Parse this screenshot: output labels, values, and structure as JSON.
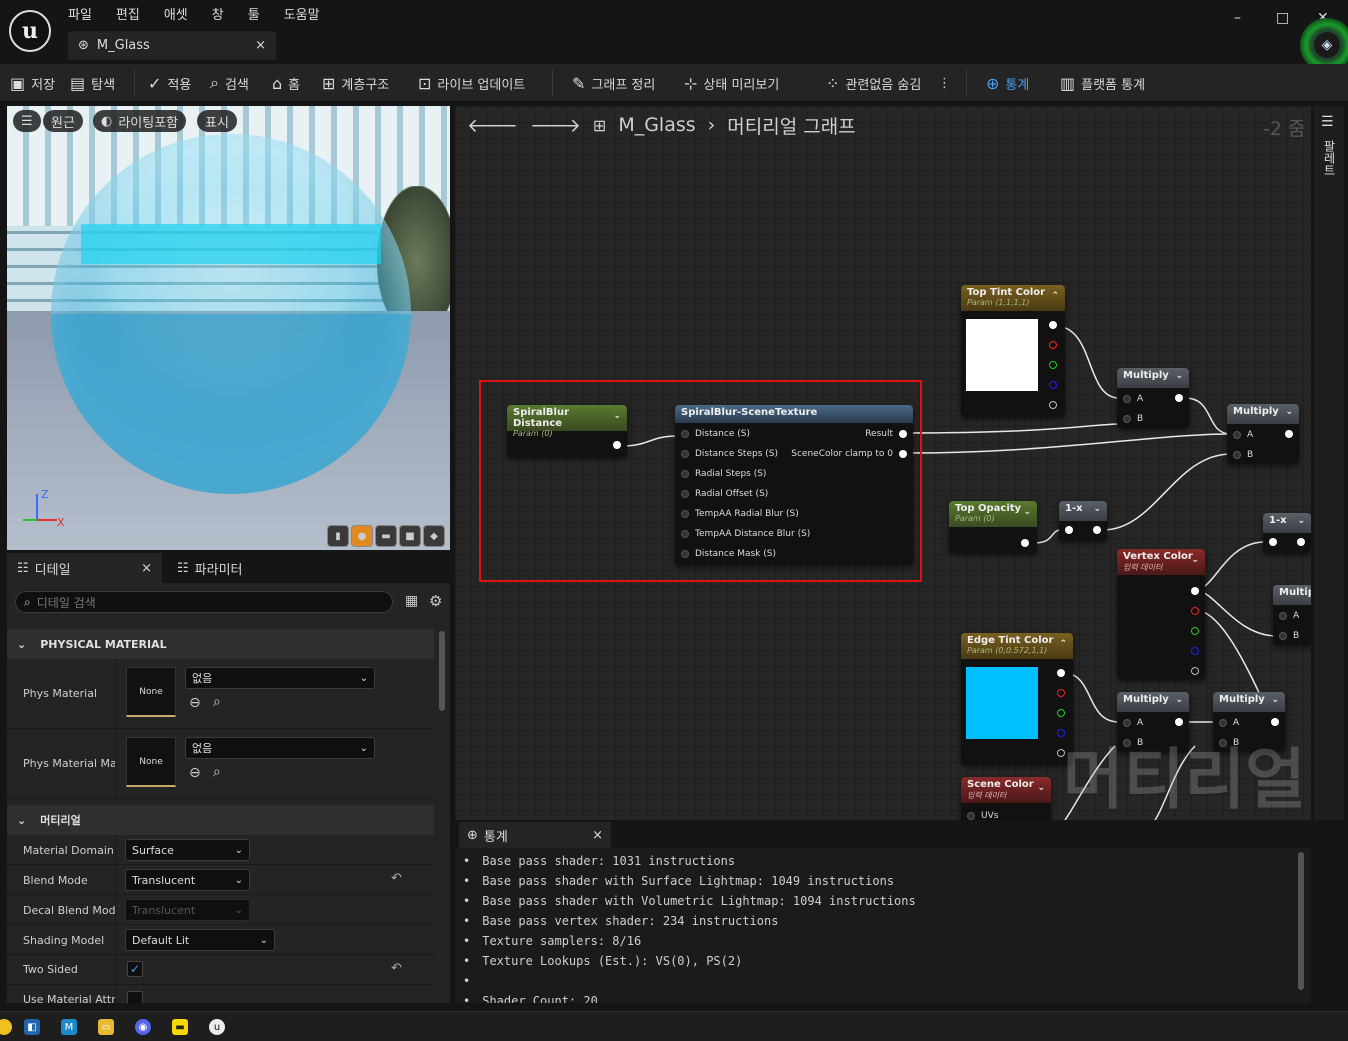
{
  "menu": {
    "items": [
      "파일",
      "편집",
      "애셋",
      "창",
      "툴",
      "도움말"
    ]
  },
  "doc_tab": {
    "label": "M_Glass",
    "close": "×"
  },
  "window": {
    "minimize": "–",
    "maximize": "□",
    "close": "✕"
  },
  "toolbar": {
    "save": "저장",
    "browse": "탐색",
    "apply": "적용",
    "search": "검색",
    "home": "홈",
    "hierarchy": "계층구조",
    "live_update": "라이브 업데이트",
    "clean_graph": "그래프 정리",
    "preview_state": "상태 미리보기",
    "hide_unrelated": "관련없음 숨김",
    "more": "⋮",
    "stats": "통계",
    "platform_stats": "플랫폼 통계"
  },
  "viewport": {
    "menu": "☰",
    "perspective": "원근",
    "lit": "라이팅포함",
    "show": "표시",
    "axis_z": "Z",
    "axis_x": "X",
    "preview_shapes": [
      "cylinder",
      "sphere",
      "plane",
      "cube",
      "custom"
    ],
    "selected_shape": "sphere"
  },
  "details": {
    "tab_details": "디테일",
    "tab_close": "×",
    "tab_params": "파라미터",
    "search_placeholder": "디테일 검색",
    "cat_physical": "PHYSICAL MATERIAL",
    "phys_material_label": "Phys Material",
    "phys_material_thumb": "None",
    "phys_material_value": "없음",
    "phys_material_mask_label": "Phys Material Ma",
    "phys_material_mask_thumb": "None",
    "phys_material_mask_value": "없음",
    "cat_material": "머티리얼",
    "material_domain_label": "Material Domain",
    "material_domain_value": "Surface",
    "blend_mode_label": "Blend Mode",
    "blend_mode_value": "Translucent",
    "decal_blend_label": "Decal Blend Mode",
    "decal_blend_value": "Translucent",
    "shading_model_label": "Shading Model",
    "shading_model_value": "Default Lit",
    "two_sided_label": "Two Sided",
    "two_sided_checked": "✓",
    "use_material_attr_label": "Use Material Attri"
  },
  "graph": {
    "back": "🡐",
    "forward": "🡒",
    "breadcrumb_asset": "M_Glass",
    "breadcrumb_sep": "›",
    "breadcrumb_graph": "머티리얼 그래프",
    "zoom": "-2 줌",
    "palette": "팔레트",
    "watermark": "머티리얼",
    "nodes": {
      "spiral_distance": {
        "title": "SpiralBlur Distance",
        "sub": "Param (0)"
      },
      "spiral_scene": {
        "title": "SpiralBlur-SceneTexture",
        "inputs": [
          "Distance (S)",
          "Distance Steps (S)",
          "Radial Steps (S)",
          "Radial Offset (S)",
          "TempAA Radial Blur (S)",
          "TempAA Distance Blur (S)",
          "Distance Mask (S)"
        ],
        "outputs": [
          "Result",
          "SceneColor clamp to 0"
        ]
      },
      "top_tint": {
        "title": "Top Tint Color",
        "sub": "Param (1,1,1,1)",
        "color": "#ffffff"
      },
      "top_opacity": {
        "title": "Top Opacity",
        "sub": "Param (0)"
      },
      "one_minus_1": {
        "title": "1-x"
      },
      "one_minus_2": {
        "title": "1-x"
      },
      "multiply_1": {
        "title": "Multiply",
        "a": "A",
        "b": "B"
      },
      "multiply_2": {
        "title": "Multiply",
        "a": "A",
        "b": "B"
      },
      "multiply_3": {
        "title": "Multip",
        "a": "A",
        "b": "B"
      },
      "multiply_4": {
        "title": "Multiply",
        "a": "A",
        "b": "B"
      },
      "multiply_5": {
        "title": "Multiply",
        "a": "A",
        "b": "B"
      },
      "vertex_color": {
        "title": "Vertex Color",
        "sub": "입력 데이터"
      },
      "edge_tint": {
        "title": "Edge Tint Color",
        "sub": "Param (0,0.572,1,1)",
        "color": "#00bfff"
      },
      "scene_color": {
        "title": "Scene Color",
        "sub": "입력 데이터",
        "pin": "UVs"
      }
    }
  },
  "stats": {
    "tab": "통계",
    "tab_close": "×",
    "lines": [
      "Base pass shader: 1031 instructions",
      "Base pass shader with Surface Lightmap: 1049 instructions",
      "Base pass shader with Volumetric Lightmap: 1094 instructions",
      "Base pass vertex shader: 234 instructions",
      "Texture samplers: 8/16",
      "Texture Lookups (Est.): VS(0), PS(2)",
      "",
      "Shader Count: 20"
    ],
    "bullet": "•"
  },
  "taskbar": {
    "apps": [
      "vscode",
      "unreal-m",
      "explorer",
      "discord",
      "kakaotalk",
      "unreal"
    ]
  },
  "colors": {
    "accent": "#4aa0f0",
    "highlight_box": "#e01010",
    "param_header": "#5a7a2e",
    "vertex_header": "#8a2a2a"
  }
}
